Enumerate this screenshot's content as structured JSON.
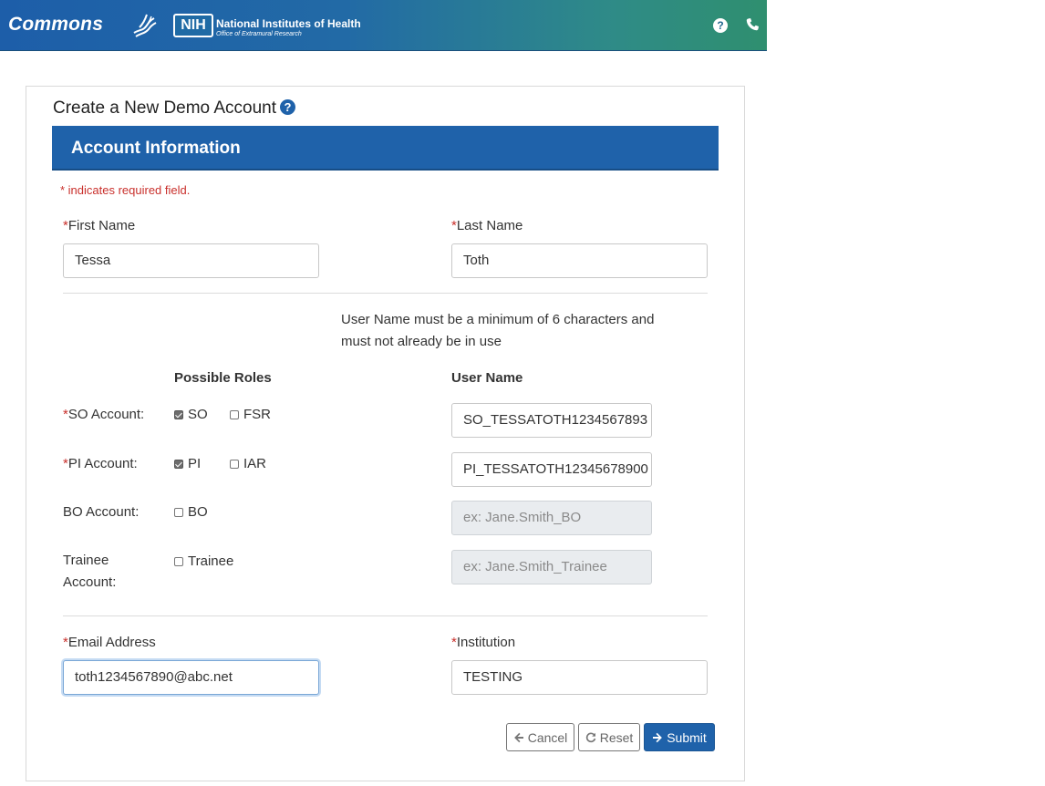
{
  "header": {
    "brand": "Commons",
    "nih_badge": "NIH",
    "nih_title": "National Institutes of Health",
    "nih_subtitle": "Office of Extramural Research",
    "help_icon": "?",
    "phone_icon": "phone-icon"
  },
  "page": {
    "title": "Create a New Demo Account",
    "section_title": "Account Information",
    "required_note": "* indicates required field."
  },
  "form": {
    "first_name": {
      "label": "First Name",
      "value": "Tessa"
    },
    "last_name": {
      "label": "Last Name",
      "value": "Toth"
    },
    "username_note": "User Name must be a minimum of 6 characters and must not already be in use",
    "possible_roles_header": "Possible Roles",
    "user_name_header": "User Name",
    "accounts": {
      "so": {
        "label": "SO Account:",
        "required": true,
        "roles": [
          {
            "label": "SO",
            "checked": true
          },
          {
            "label": "FSR",
            "checked": false
          }
        ],
        "username": "SO_TESSATOTH1234567893"
      },
      "pi": {
        "label": "PI Account:",
        "required": true,
        "roles": [
          {
            "label": "PI",
            "checked": true
          },
          {
            "label": "IAR",
            "checked": false
          }
        ],
        "username": "PI_TESSATOTH12345678900"
      },
      "bo": {
        "label": "BO Account:",
        "required": false,
        "roles": [
          {
            "label": "BO",
            "checked": false
          }
        ],
        "placeholder": "ex: Jane.Smith_BO"
      },
      "trainee": {
        "label_line1": "Trainee",
        "label_line2": "Account:",
        "required": false,
        "roles": [
          {
            "label": "Trainee",
            "checked": false
          }
        ],
        "placeholder": "ex: Jane.Smith_Trainee"
      }
    },
    "email": {
      "label": "Email Address",
      "value": "toth1234567890@abc.net"
    },
    "institution": {
      "label": "Institution",
      "value": "TESTING"
    }
  },
  "buttons": {
    "cancel": "Cancel",
    "reset": "Reset",
    "submit": "Submit"
  },
  "colors": {
    "primary": "#1f62aa",
    "required": "#c9302c"
  }
}
